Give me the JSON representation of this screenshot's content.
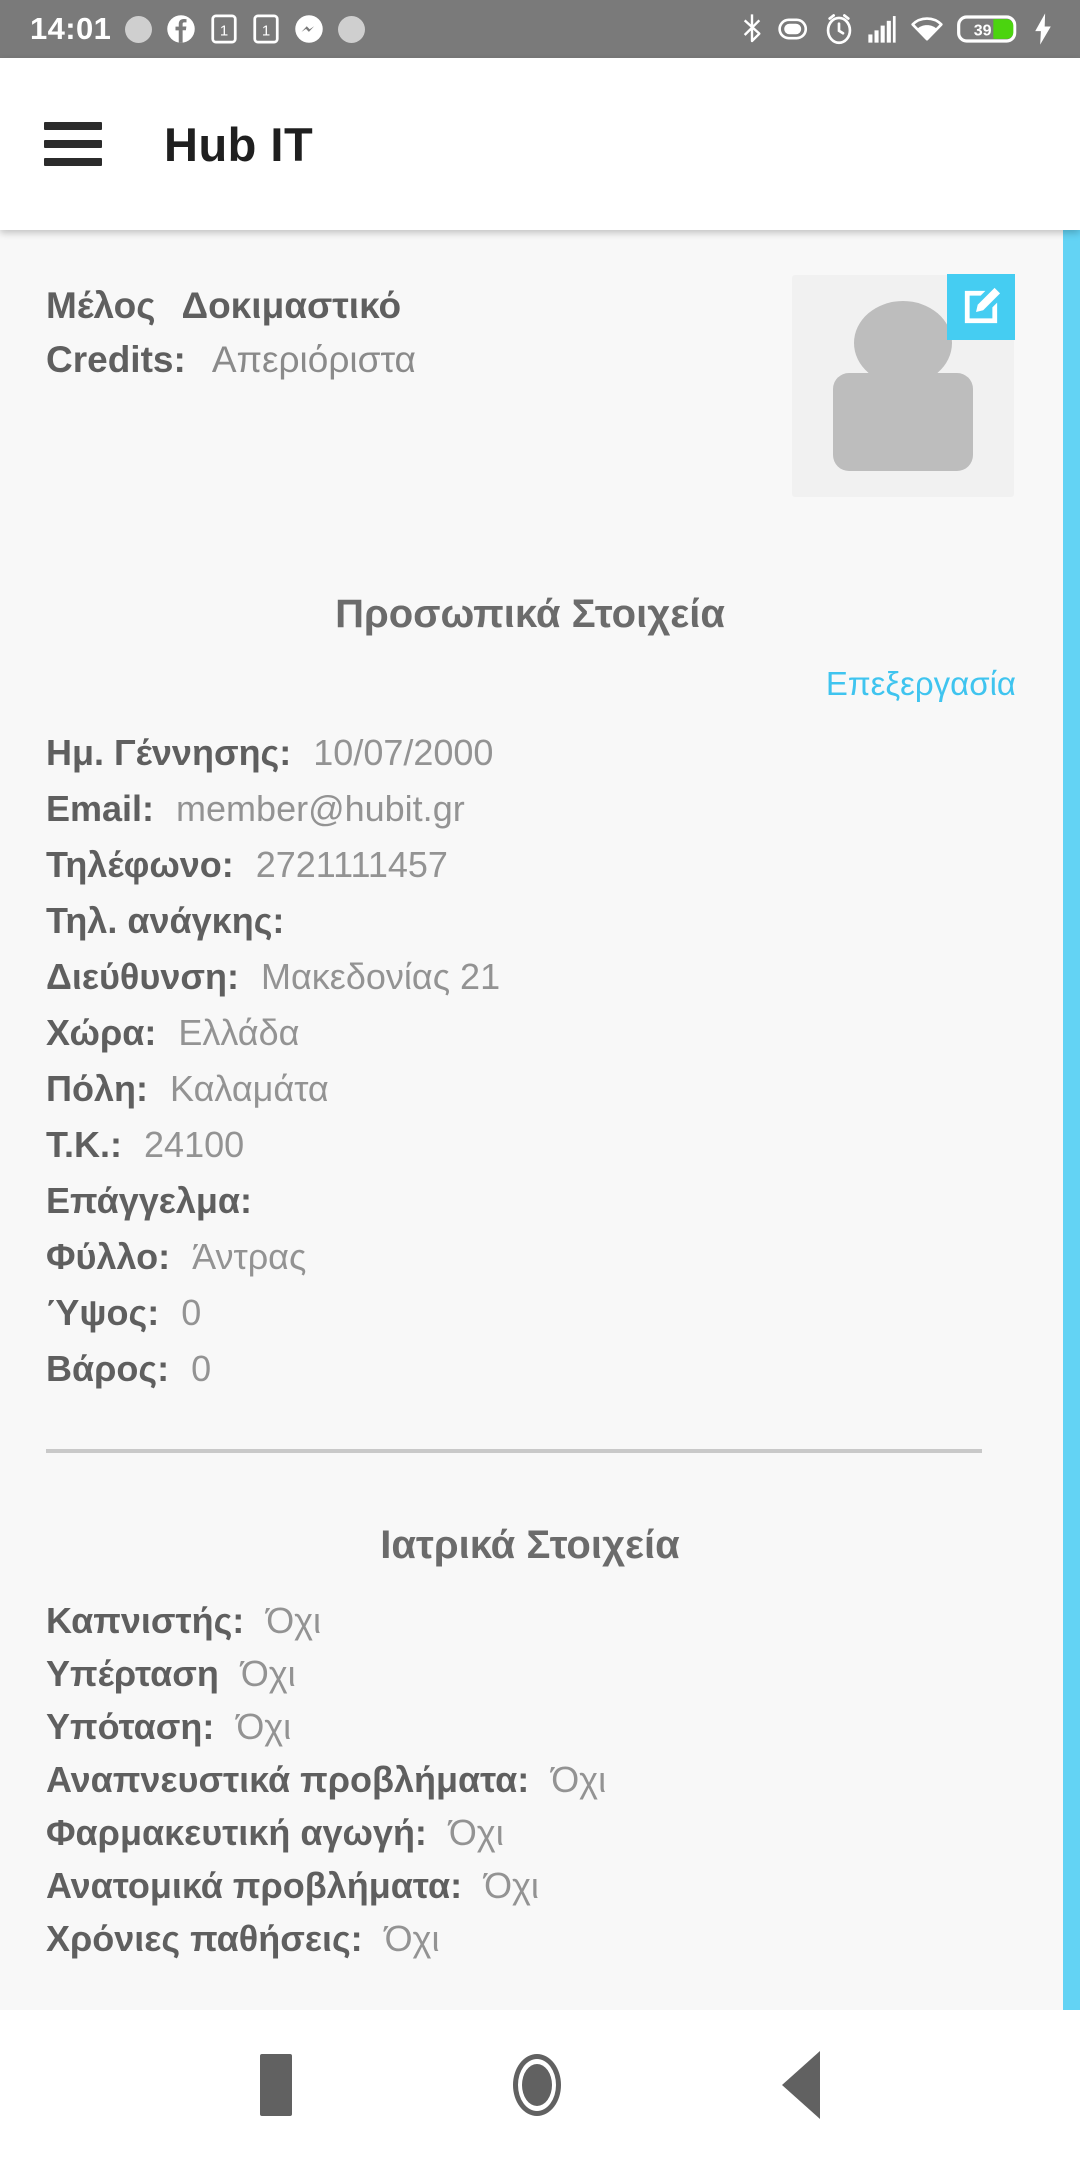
{
  "status_bar": {
    "clock": "14:01",
    "left_icons": [
      "loading-dot-icon",
      "facebook-icon",
      "notification-1-icon",
      "notification-1-alt-icon",
      "messenger-icon",
      "loading-dot-2-icon"
    ],
    "right_icons": [
      "bluetooth-icon",
      "do-not-disturb-icon",
      "alarm-icon",
      "cellular-signal-icon",
      "wifi-icon"
    ],
    "battery_level": "39",
    "battery_charging": true,
    "background": "#7a7a7a"
  },
  "app_bar": {
    "menu_icon": "hamburger-menu-icon",
    "title": "Hub IT"
  },
  "member": {
    "type_label": "Μέλος",
    "type_value": "Δοκιμαστικό",
    "credits_label": "Credits:",
    "credits_value": "Απεριόριστα",
    "avatar_icon": "person-placeholder-icon",
    "edit_badge_icon": "edit-pencil-icon",
    "edit_badge_color": "#45cdf2"
  },
  "personal": {
    "title": "Προσωπικά Στοιχεία",
    "edit_label": "Επεξεργασία",
    "edit_color": "#3fc4ef",
    "fields": [
      {
        "label": "Ημ. Γέννησης:",
        "value": "10/07/2000"
      },
      {
        "label": "Email:",
        "value": "member@hubit.gr"
      },
      {
        "label": "Τηλέφωνο:",
        "value": "2721111457"
      },
      {
        "label": "Τηλ. ανάγκης:",
        "value": ""
      },
      {
        "label": "Διεύθυνση:",
        "value": "Μακεδονίας 21"
      },
      {
        "label": "Χώρα:",
        "value": "Ελλάδα"
      },
      {
        "label": "Πόλη:",
        "value": "Καλαμάτα"
      },
      {
        "label": "Τ.Κ.:",
        "value": "24100"
      },
      {
        "label": "Επάγγελμα:",
        "value": ""
      },
      {
        "label": "Φύλλο:",
        "value": "Άντρας"
      },
      {
        "label": "Ύψος:",
        "value": "0"
      },
      {
        "label": "Βάρος:",
        "value": "0"
      }
    ]
  },
  "medical": {
    "title": "Ιατρικά Στοιχεία",
    "fields": [
      {
        "label": "Καπνιστής:",
        "value": "Όχι"
      },
      {
        "label": "Υπέρταση",
        "value": "Όχι"
      },
      {
        "label": "Υπόταση:",
        "value": "Όχι"
      },
      {
        "label": "Αναπνευστικά προβλήματα:",
        "value": "Όχι"
      },
      {
        "label": "Φαρμακευτική αγωγή:",
        "value": "Όχι"
      },
      {
        "label": "Ανατομικά προβλήματα:",
        "value": "Όχι"
      },
      {
        "label": "Χρόνιες παθήσεις:",
        "value": "Όχι"
      }
    ]
  },
  "scrollbar": {
    "color": "#63d3f4"
  },
  "nav_bar": {
    "recents_icon": "square-recents-icon",
    "home_icon": "circle-home-icon",
    "back_icon": "triangle-back-icon"
  }
}
